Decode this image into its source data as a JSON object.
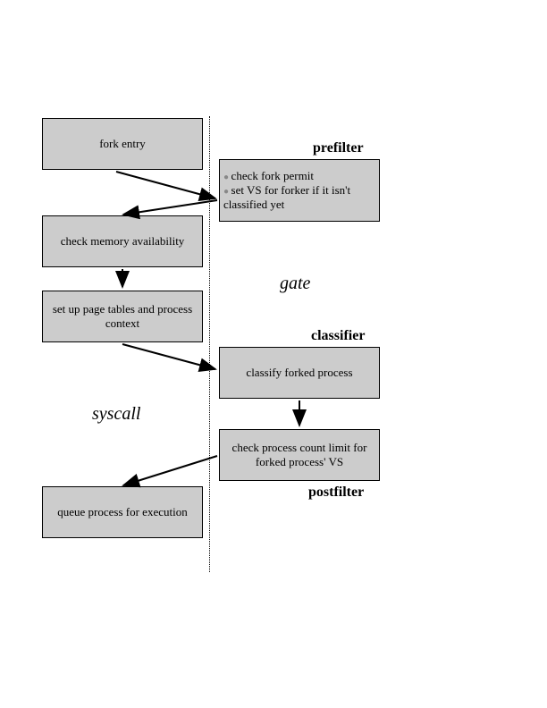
{
  "left": {
    "box1": "fork entry",
    "box2": "check memory availability",
    "box3": "set up page tables and process context",
    "box4": "queue process for execution",
    "label": "syscall"
  },
  "right": {
    "prefilter_label": "prefilter",
    "prefilter_item1": "check fork permit",
    "prefilter_item2": "set VS for forker if it isn't classified yet",
    "gate_label": "gate",
    "classifier_label": "classifier",
    "classifier_box": "classify forked process",
    "postfilter_box": "check process count limit for forked process' VS",
    "postfilter_label": "postfilter"
  }
}
